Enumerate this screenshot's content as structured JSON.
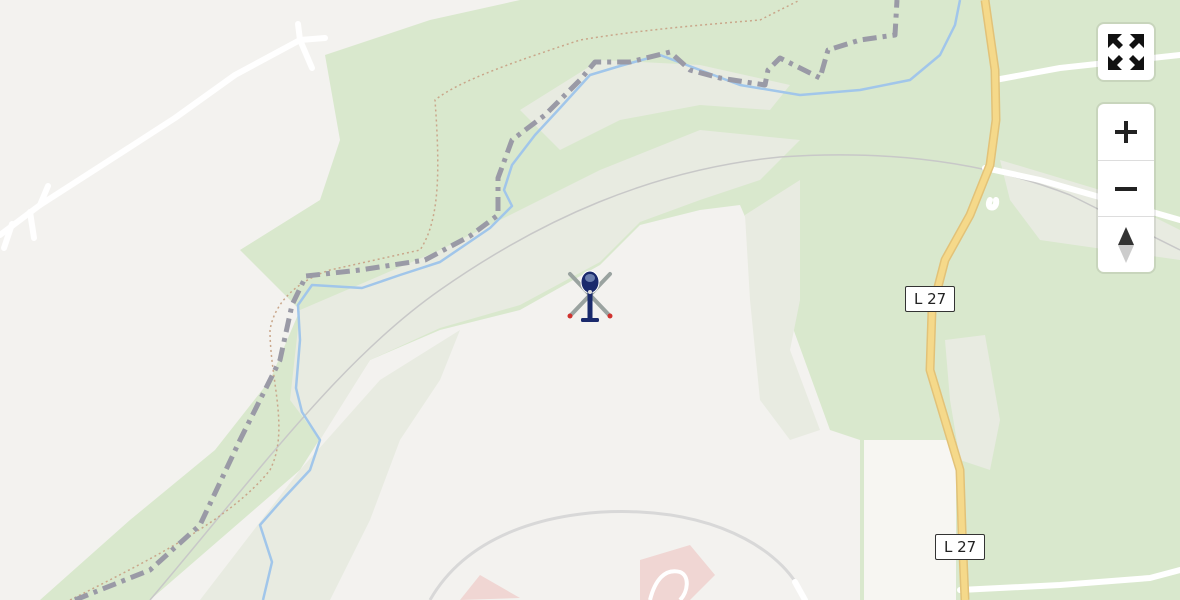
{
  "map": {
    "colors": {
      "background": "#f3f2ef",
      "forest": "#d9e8cd",
      "clearing": "#e8ebe1",
      "river": "#a1c6ea",
      "main_road": "#f5d98a",
      "boundary": "#9a9aa6",
      "trail": "#c9a68a",
      "minor_road": "#ffffff",
      "helicopter": "#1a2a6c"
    },
    "road_labels": [
      {
        "id": "road-label-l27-upper",
        "text": "L 27"
      },
      {
        "id": "road-label-l27-lower",
        "text": "L 27"
      }
    ],
    "marker": {
      "icon": "helicopter-icon"
    }
  },
  "controls": {
    "fullscreen": {
      "icon": "fullscreen-icon"
    },
    "zoom_in": {
      "icon": "plus-icon"
    },
    "zoom_out": {
      "icon": "minus-icon"
    },
    "compass": {
      "icon": "compass-icon"
    }
  }
}
